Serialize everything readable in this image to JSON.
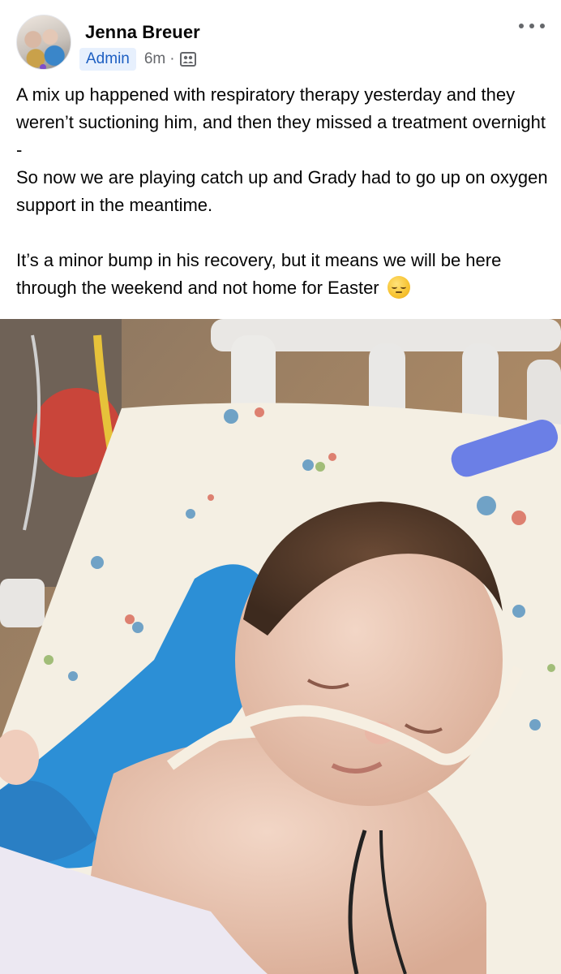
{
  "post": {
    "author": "Jenna Breuer",
    "badge": "Admin",
    "time": "6m",
    "separator": "·",
    "audience_icon": "group-icon",
    "more_icon": "more-options-icon",
    "paragraphs": [
      "A mix up happened with respiratory therapy yesterday and they weren’t suctioning him, and then they missed a treatment overnight -",
      "So now we are playing catch up and Grady had to go up on oxygen support in the meantime.",
      "It’s a minor bump in his recovery, but it means we will be here through the weekend and not home for Easter"
    ],
    "emoji_name": "pensive-face-emoji",
    "photo_subject": "post-photo"
  },
  "colors": {
    "admin_badge_bg": "#e7f0fd",
    "admin_badge_text": "#1d5fc2",
    "secondary_text": "#65676b"
  }
}
